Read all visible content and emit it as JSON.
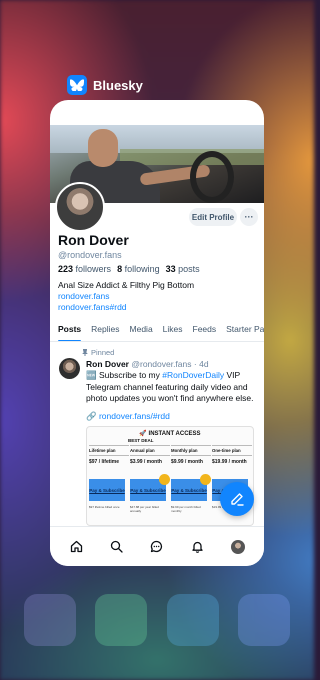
{
  "app_switcher": {
    "app_name": "Bluesky"
  },
  "profile": {
    "display_name": "Ron Dover",
    "handle": "@rondover.fans",
    "followers_count": "223",
    "followers_label": "followers",
    "following_count": "8",
    "following_label": "following",
    "posts_count": "33",
    "posts_label": "posts",
    "bio": "Anal Size Addict & Filthy Pig Bottom",
    "links": [
      "rondover.fans",
      "rondover.fans#rdd"
    ],
    "edit_button": "Edit Profile",
    "more_button": "···"
  },
  "tabs": [
    "Posts",
    "Replies",
    "Media",
    "Likes",
    "Feeds",
    "Starter Packs"
  ],
  "active_tab": "Posts",
  "post": {
    "pinned_label": "Pinned",
    "author": "Ron Dover",
    "author_handle": "@rondover.fans",
    "separator": "·",
    "time": "4d",
    "text_prefix": "🆕 Subscribe to my ",
    "hashtag": "#RonDoverDaily",
    "text_suffix": " VIP Telegram channel featuring daily video and photo updates you won't find anywhere else.",
    "link_emoji": "🔗",
    "link": "rondover.fans/#rdd",
    "embed": {
      "title": "🚀 INSTANT ACCESS",
      "badge": "BEST DEAL",
      "plans": [
        {
          "name": "Lifetime plan",
          "price": "$97 / lifetime",
          "cta": "Pay & Subscribe",
          "note": "$97 lifetime billed once"
        },
        {
          "name": "Annual plan",
          "price": "$3.99 / month",
          "cta": "Pay & Subscribe",
          "note": "$47.88 per year billed annually"
        },
        {
          "name": "Monthly plan",
          "price": "$9.99 / month",
          "cta": "Pay & Subscribe",
          "note": "$9.99 per month billed monthly"
        },
        {
          "name": "One-time plan",
          "price": "$19.99 / month",
          "cta": "Pay & Subscribe",
          "note": "$19.99 one time billed once"
        }
      ]
    }
  },
  "colors": {
    "accent": "#1185fe",
    "text": "#0b0f14",
    "muted": "#6f869f"
  },
  "icons": {
    "nav": [
      "home-icon",
      "search-icon",
      "chat-icon",
      "bell-icon",
      "profile-avatar"
    ],
    "fab": "compose-icon"
  }
}
